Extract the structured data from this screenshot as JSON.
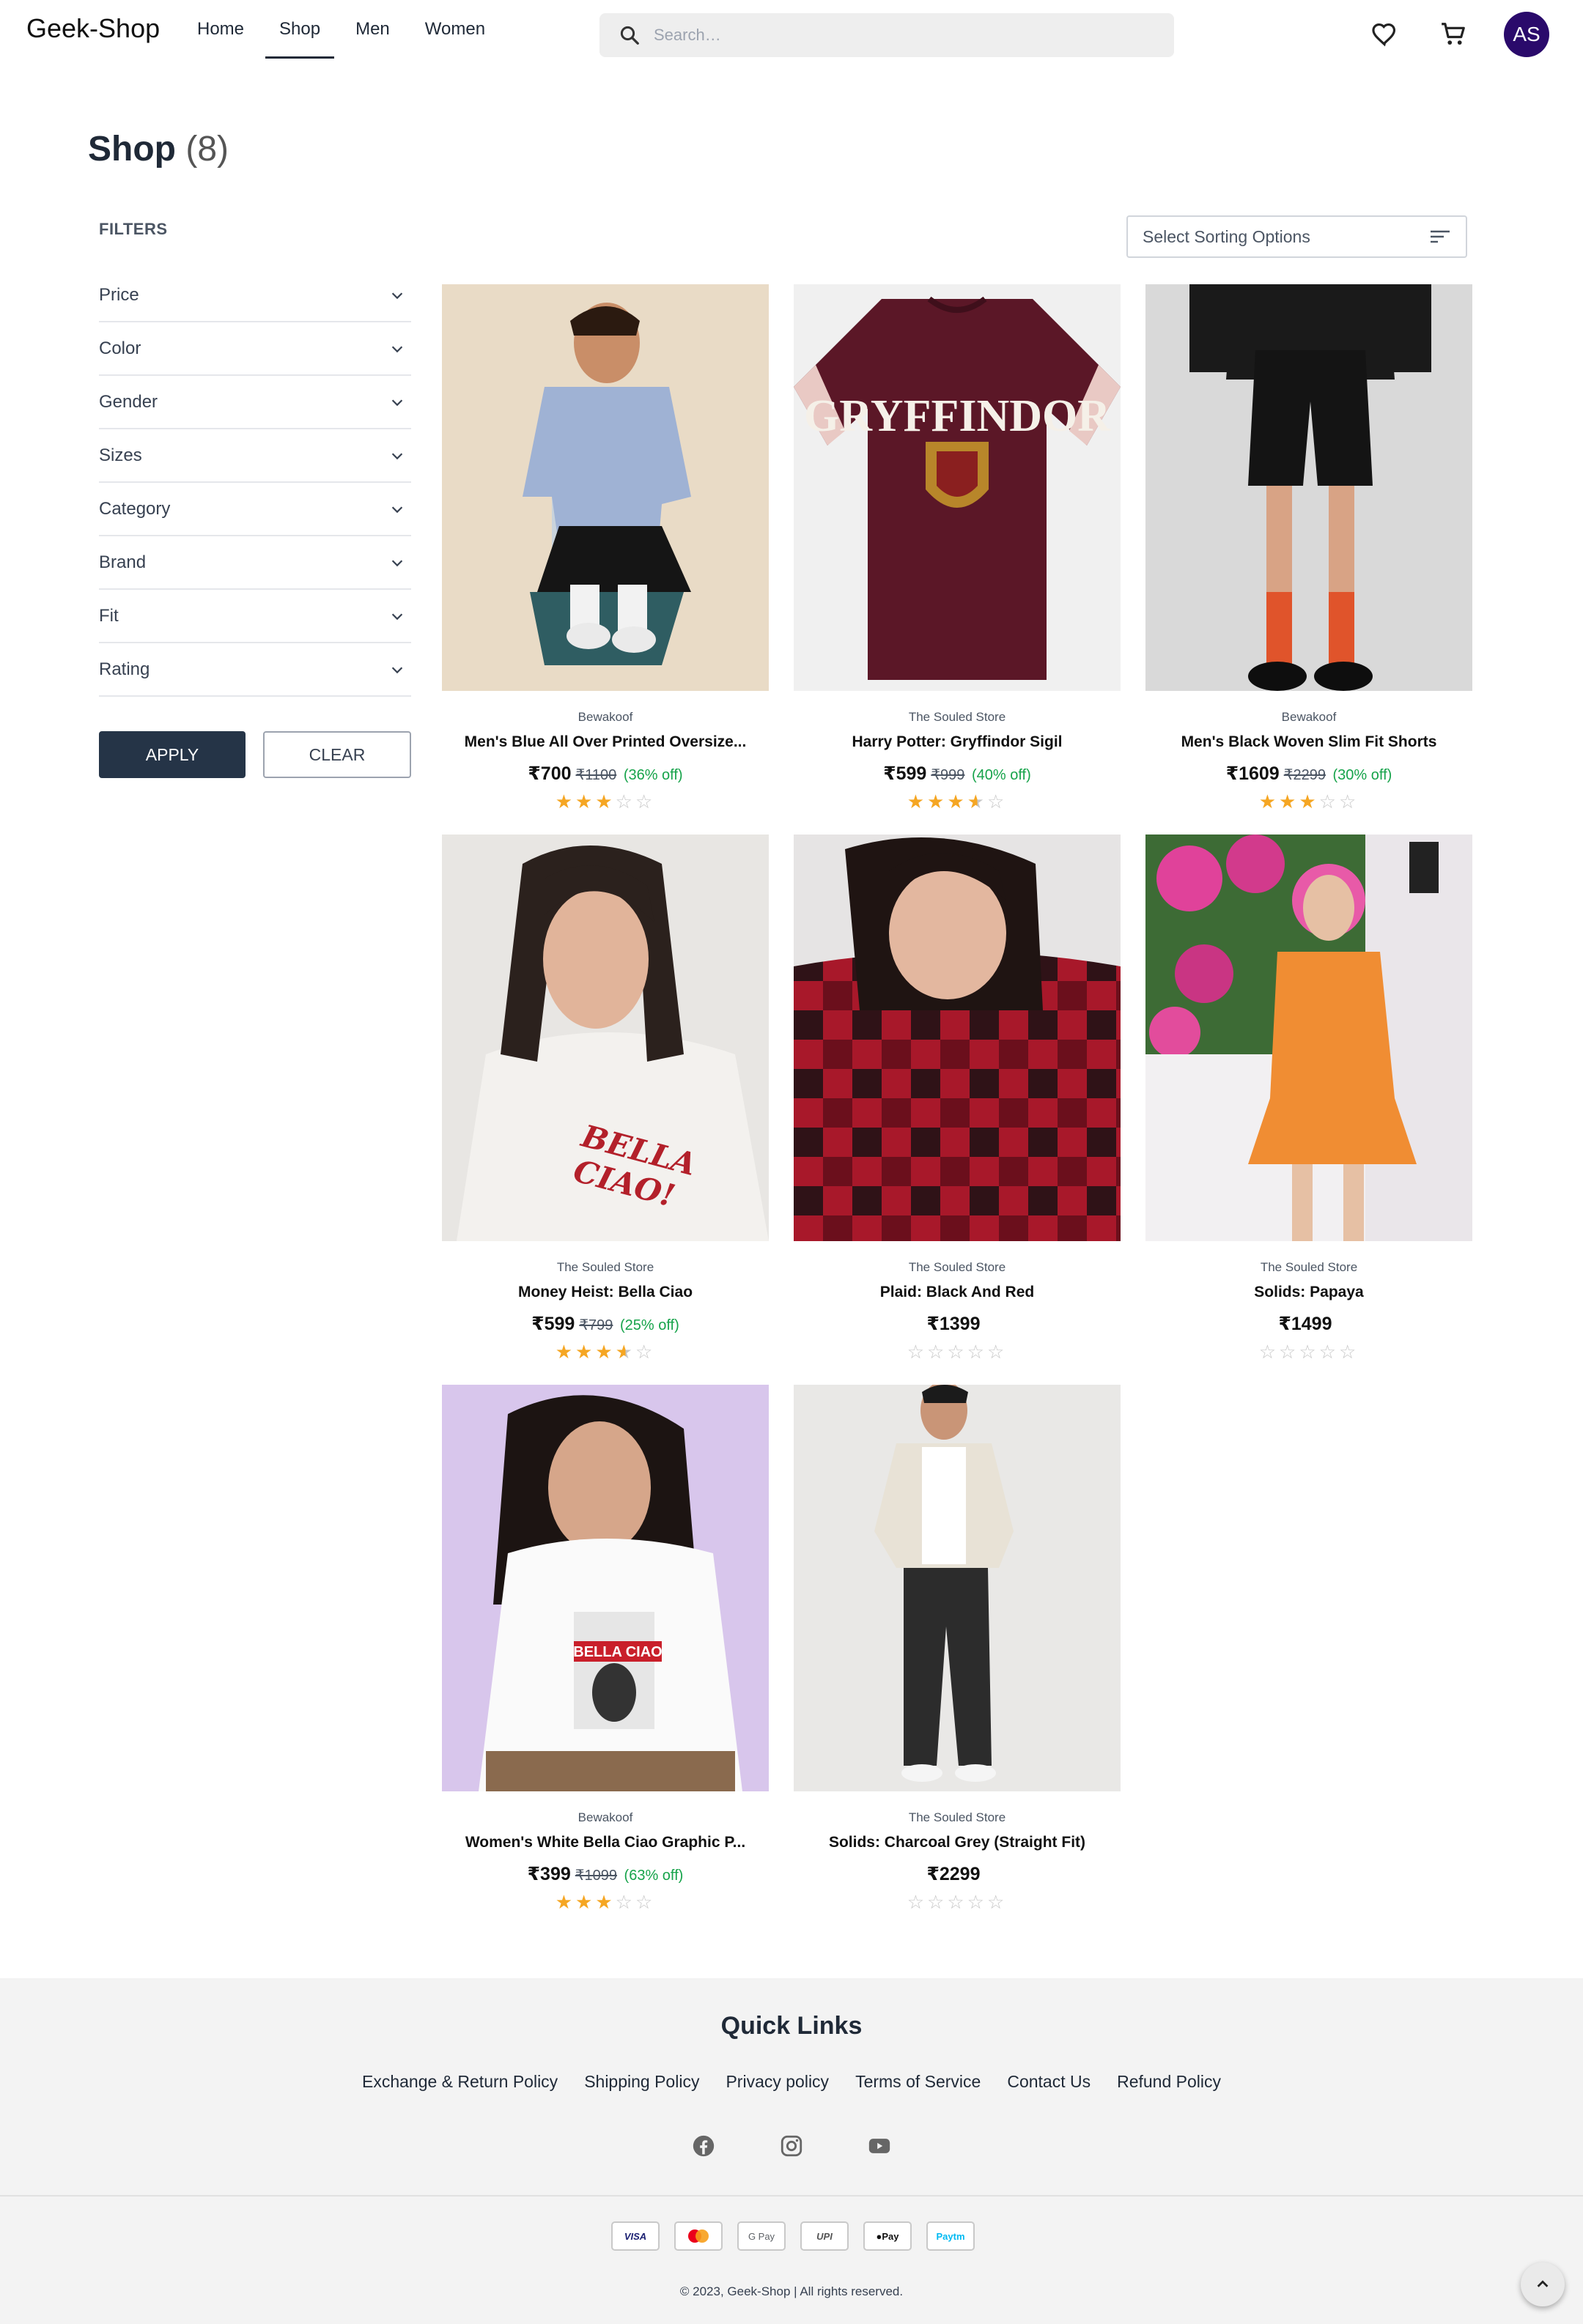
{
  "header": {
    "logo": "Geek-Shop",
    "nav": [
      {
        "label": "Home",
        "active": false
      },
      {
        "label": "Shop",
        "active": true
      },
      {
        "label": "Men",
        "active": false
      },
      {
        "label": "Women",
        "active": false
      }
    ],
    "search_placeholder": "Search…",
    "avatar_initials": "AS",
    "avatar_color": "#2a0a6b"
  },
  "page": {
    "title": "Shop",
    "count": "(8)"
  },
  "filters": {
    "label": "FILTERS",
    "items": [
      "Price",
      "Color",
      "Gender",
      "Sizes",
      "Category",
      "Brand",
      "Fit",
      "Rating"
    ],
    "apply_label": "APPLY",
    "clear_label": "CLEAR"
  },
  "sort": {
    "placeholder": "Select Sorting Options"
  },
  "products": [
    {
      "brand": "Bewakoof",
      "name": "Men's Blue All Over Printed Oversize...",
      "price": "₹700",
      "mrp": "₹1100",
      "discount": "(36% off)",
      "rating": 3
    },
    {
      "brand": "The Souled Store",
      "name": "Harry Potter: Gryffindor Sigil",
      "price": "₹599",
      "mrp": "₹999",
      "discount": "(40% off)",
      "rating": 3.5
    },
    {
      "brand": "Bewakoof",
      "name": "Men's Black Woven Slim Fit Shorts",
      "price": "₹1609",
      "mrp": "₹2299",
      "discount": "(30% off)",
      "rating": 3
    },
    {
      "brand": "The Souled Store",
      "name": "Money Heist: Bella Ciao",
      "price": "₹599",
      "mrp": "₹799",
      "discount": "(25% off)",
      "rating": 3.5
    },
    {
      "brand": "The Souled Store",
      "name": "Plaid: Black And Red",
      "price": "₹1399",
      "mrp": "",
      "discount": "",
      "rating": 0
    },
    {
      "brand": "The Souled Store",
      "name": "Solids: Papaya",
      "price": "₹1499",
      "mrp": "",
      "discount": "",
      "rating": 0
    },
    {
      "brand": "Bewakoof",
      "name": "Women's White Bella Ciao Graphic P...",
      "price": "₹399",
      "mrp": "₹1099",
      "discount": "(63% off)",
      "rating": 3
    },
    {
      "brand": "The Souled Store",
      "name": "Solids: Charcoal Grey (Straight Fit)",
      "price": "₹2299",
      "mrp": "",
      "discount": "",
      "rating": 0
    }
  ],
  "footer": {
    "quick_links_title": "Quick Links",
    "links": [
      "Exchange & Return Policy",
      "Shipping Policy",
      "Privacy policy",
      "Terms of Service",
      "Contact Us",
      "Refund Policy"
    ],
    "social": [
      "facebook-icon",
      "instagram-icon",
      "youtube-icon"
    ],
    "payments": [
      "VISA",
      "",
      "G Pay",
      "UPI",
      "Pay",
      "Paytm"
    ],
    "copyright": "© 2023, Geek-Shop | All rights reserved."
  },
  "colors": {
    "accent_dark": "#253447",
    "discount_green": "#16a34a",
    "star": "#f5a623"
  }
}
